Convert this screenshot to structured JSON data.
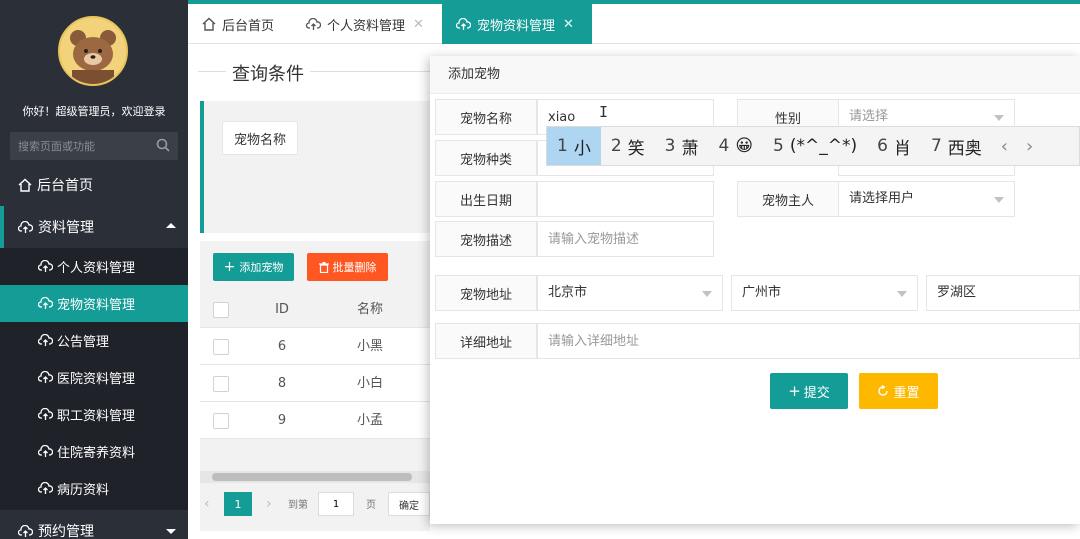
{
  "sidebar": {
    "greeting": "你好！超级管理员，欢迎登录",
    "search_placeholder": "搜索页面或功能",
    "home": "后台首页",
    "data_mgmt": "资料管理",
    "sub_items": [
      "个人资料管理",
      "宠物资料管理",
      "公告管理",
      "医院资料管理",
      "职工资料管理",
      "住院寄养资料",
      "病历资料"
    ],
    "appointment": "预约管理"
  },
  "tabs": [
    {
      "label": "后台首页"
    },
    {
      "label": "个人资料管理"
    },
    {
      "label": "宠物资料管理"
    }
  ],
  "query": {
    "title": "查询条件",
    "pet_name_label": "宠物名称"
  },
  "toolbar": {
    "add": "添加宠物",
    "batch_delete": "批量删除"
  },
  "table": {
    "headers": [
      "ID",
      "名称"
    ],
    "rows": [
      {
        "id": "6",
        "name": "小黑"
      },
      {
        "id": "8",
        "name": "小白"
      },
      {
        "id": "9",
        "name": "小孟"
      }
    ]
  },
  "pager": {
    "current": "1",
    "goto": "到第",
    "page_input": "1",
    "page_unit": "页",
    "confirm": "确定"
  },
  "modal": {
    "title": "添加宠物",
    "name_label": "宠物名称",
    "name_value": "xiao",
    "gender_label": "性别",
    "gender_placeholder": "请选择",
    "species_label": "宠物种类",
    "birth_label": "出生日期",
    "owner_label": "宠物主人",
    "owner_placeholder": "请选择用户",
    "desc_label": "宠物描述",
    "desc_placeholder": "请输入宠物描述",
    "addr_label": "宠物地址",
    "province": "北京市",
    "city": "广州市",
    "district": "罗湖区",
    "detail_label": "详细地址",
    "detail_placeholder": "请输入详细地址",
    "submit": "提交",
    "reset": "重置"
  },
  "ime": {
    "candidates": [
      {
        "n": "1",
        "t": "小"
      },
      {
        "n": "2",
        "t": "笑"
      },
      {
        "n": "3",
        "t": "萧"
      },
      {
        "n": "4",
        "t": "😀"
      },
      {
        "n": "5",
        "t": "(*^_^*)"
      },
      {
        "n": "6",
        "t": "肖"
      },
      {
        "n": "7",
        "t": "西奥"
      }
    ]
  },
  "colors": {
    "accent": "#149c96",
    "danger": "#ff5722",
    "warn": "#ffb800",
    "sidebar": "#2b2f38"
  }
}
